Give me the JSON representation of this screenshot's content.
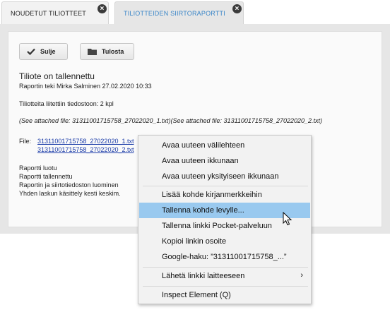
{
  "tabs": [
    {
      "label": "NOUDETUT TILIOTTEET",
      "close": "×"
    },
    {
      "label": "TILIOTTEIDEN SIIRTORAPORTTI",
      "close": "×"
    }
  ],
  "toolbar": {
    "close_label": "Sulje",
    "print_label": "Tulosta"
  },
  "report": {
    "title": "Tiliote on tallennettu",
    "author_line": "Raportin teki Mirka Salminen 27.02.2020 10:33",
    "attached_count": "Tiliotteita liitettiin tiedostoon: 2 kpl",
    "attached_files_line": "(See attached file: 31311001715758_27022020_1.txt)(See attached file: 31311001715758_27022020_2.txt)",
    "file_label": "File:",
    "file_link_1": "31311001715758_27022020_1.txt",
    "file_link_2": "31311001715758_27022020_2.txt",
    "log_1": "Raportti luotu",
    "log_2": "Raportti tallennettu",
    "log_3": "Raportin ja siirtotiedoston luominen",
    "log_4": "Yhden laskun käsittely kesti keskim."
  },
  "context_menu": {
    "items": [
      "Avaa uuteen välilehteen",
      "Avaa uuteen ikkunaan",
      "Avaa uuteen yksityiseen ikkunaan",
      "Lisää kohde kirjanmerkkeihin",
      "Tallenna kohde levylle...",
      "Tallenna linkki Pocket-palveluun",
      "Kopioi linkin osoite",
      "Google-haku: ”31311001715758_...”",
      "Lähetä linkki laitteeseen",
      "Inspect Element (Q)"
    ],
    "submenu_arrow": "›",
    "highlighted_item": "Tallenna kohde levylle..."
  },
  "colors": {
    "link": "#1a3ba8",
    "highlight": "#99c9ef",
    "active_tab_text": "#3a86c8"
  }
}
